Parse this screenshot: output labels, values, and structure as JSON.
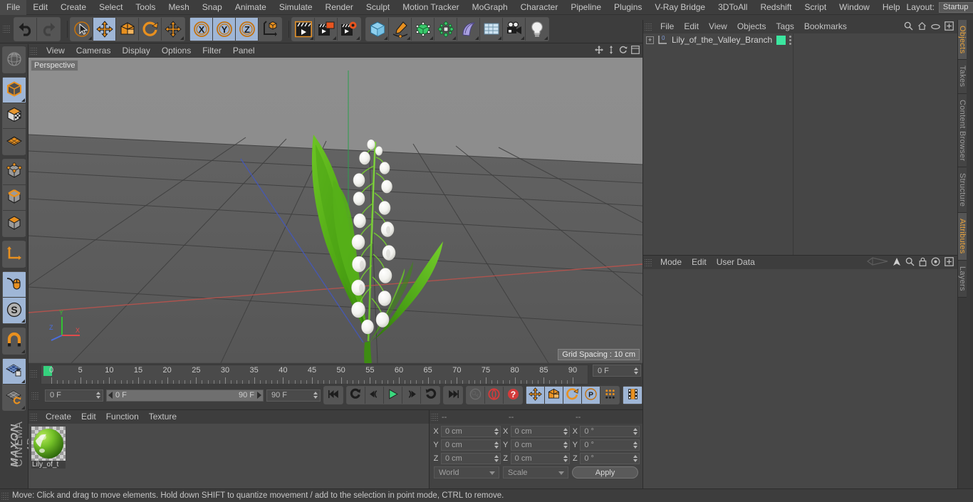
{
  "app": {
    "brand_line1": "MAXON",
    "brand_line2": "CINEMA 4D"
  },
  "menubar": {
    "items": [
      "File",
      "Edit",
      "Create",
      "Select",
      "Tools",
      "Mesh",
      "Snap",
      "Animate",
      "Simulate",
      "Render",
      "Sculpt",
      "Motion Tracker",
      "MoGraph",
      "Character",
      "Pipeline",
      "Plugins",
      "V-Ray Bridge",
      "3DToAll",
      "Redshift",
      "Script",
      "Window",
      "Help"
    ],
    "layout_label": "Layout:",
    "layout_value": "Startup",
    "search_icon": "search-icon"
  },
  "toolbar": {
    "groups": [
      {
        "name": "history",
        "buttons": [
          {
            "name": "undo-button",
            "icon": "undo-icon",
            "selected": false
          },
          {
            "name": "redo-button",
            "icon": "redo-icon",
            "selected": false
          }
        ]
      },
      {
        "name": "tools",
        "buttons": [
          {
            "name": "select-tool-button",
            "icon": "cursor-select-icon",
            "selected": false
          },
          {
            "name": "move-tool-button",
            "icon": "move-arrows-icon",
            "selected": true
          },
          {
            "name": "scale-tool-button",
            "icon": "scale-box-icon",
            "selected": false
          },
          {
            "name": "rotate-tool-button",
            "icon": "rotate-circle-icon",
            "selected": false
          },
          {
            "name": "move-alt-tool-button",
            "icon": "move-arrows-icon",
            "selected": false
          }
        ]
      },
      {
        "name": "axis-locks",
        "buttons": [
          {
            "name": "x-axis-lock-button",
            "icon": "x-axis-icon",
            "selected": true
          },
          {
            "name": "y-axis-lock-button",
            "icon": "y-axis-icon",
            "selected": true
          },
          {
            "name": "z-axis-lock-button",
            "icon": "z-axis-icon",
            "selected": true
          },
          {
            "name": "world-coordinate-button",
            "icon": "world-axis-cube-icon",
            "selected": false
          }
        ]
      },
      {
        "name": "render",
        "buttons": [
          {
            "name": "render-view-button",
            "icon": "clapboard-icon",
            "selected": false
          },
          {
            "name": "render-to-picture-viewer-button",
            "icon": "clapboard-window-icon",
            "selected": false
          },
          {
            "name": "render-settings-button",
            "icon": "clapboard-gear-icon",
            "selected": false
          }
        ]
      },
      {
        "name": "objects",
        "buttons": [
          {
            "name": "add-cube-button",
            "icon": "cube-icon",
            "selected": false
          },
          {
            "name": "add-spline-button",
            "icon": "pen-spline-icon",
            "selected": false
          },
          {
            "name": "add-generator-button",
            "icon": "generator-cube-icon",
            "selected": false
          },
          {
            "name": "add-mograph-button",
            "icon": "cloner-icon",
            "selected": false
          },
          {
            "name": "add-deformer-button",
            "icon": "bend-deformer-icon",
            "selected": false
          },
          {
            "name": "add-environment-button",
            "icon": "floor-grid-icon",
            "selected": false
          },
          {
            "name": "add-camera-button",
            "icon": "camera-icon",
            "selected": false
          },
          {
            "name": "add-light-button",
            "icon": "light-bulb-icon",
            "selected": false
          }
        ]
      }
    ]
  },
  "left_toolbar": {
    "groups": [
      [
        {
          "name": "undo-view-button",
          "icon": "globe-wire-icon",
          "selected": false
        }
      ],
      [
        {
          "name": "model-mode-button",
          "icon": "model-cube-icon",
          "selected": true
        },
        {
          "name": "texture-mode-button",
          "icon": "texture-cube-icon",
          "selected": false
        },
        {
          "name": "uv-mode-button",
          "icon": "uv-mesh-icon",
          "selected": false
        }
      ],
      [
        {
          "name": "points-mode-button",
          "icon": "points-cube-icon",
          "selected": false
        },
        {
          "name": "edges-mode-button",
          "icon": "edges-cube-icon",
          "selected": false
        },
        {
          "name": "polygons-mode-button",
          "icon": "polygons-cube-icon",
          "selected": false
        }
      ],
      [
        {
          "name": "axis-modify-button",
          "icon": "axis-l-icon",
          "selected": false
        }
      ],
      [
        {
          "name": "viewport-solo-button",
          "icon": "mouse-axis-icon",
          "selected": true
        },
        {
          "name": "scale-snap-button",
          "icon": "s-circle-icon",
          "selected": true
        }
      ],
      [
        {
          "name": "enable-snapping-button",
          "icon": "magnet-icon",
          "selected": false
        }
      ],
      [
        {
          "name": "workplane-lock-button",
          "icon": "grid-lock-icon",
          "selected": true
        },
        {
          "name": "workplane-rotate-button",
          "icon": "grid-rotate-icon",
          "selected": false
        }
      ]
    ]
  },
  "viewport": {
    "menu": [
      "View",
      "Cameras",
      "Display",
      "Options",
      "Filter",
      "Panel"
    ],
    "view_label": "Perspective",
    "grid_spacing": "Grid Spacing : 10 cm",
    "axis_labels": {
      "x": "X",
      "y": "Y",
      "z": "Z"
    },
    "axis_colors": {
      "x": "#e04b4b",
      "y": "#33c233",
      "z": "#4a6ee0"
    },
    "background_top": "#8a8a8a",
    "background_bottom": "#5a5a5a",
    "icons": [
      "move-view-icon",
      "scale-view-icon",
      "rotate-view-icon",
      "maximize-view-icon"
    ],
    "scene_object": "Lily_of_the_Valley_Branch"
  },
  "object_manager": {
    "menu": [
      "File",
      "Edit",
      "View",
      "Objects",
      "Tags",
      "Bookmarks"
    ],
    "icons": [
      "search-icon",
      "home-icon",
      "ellipse-icon",
      "new-tab-icon"
    ],
    "object_name": "Lily_of_the_Valley_Branch",
    "object_layer_badge": "0",
    "tag_color": "#3ce6a0"
  },
  "attributes_manager": {
    "menu": [
      "Mode",
      "Edit",
      "User Data"
    ],
    "icons": [
      "history-icon",
      "arrow-up-icon",
      "search-icon",
      "lock-icon",
      "target-icon",
      "new-tab-icon"
    ]
  },
  "vertical_tabs": [
    {
      "label": "Objects",
      "active": true
    },
    {
      "label": "Takes",
      "active": false
    },
    {
      "label": "Content Browser",
      "active": false
    },
    {
      "label": "Structure",
      "active": false
    },
    {
      "label": "Attributes",
      "active": true
    },
    {
      "label": "Layers",
      "active": false
    }
  ],
  "timeline": {
    "ticks": [
      0,
      5,
      10,
      15,
      20,
      25,
      30,
      35,
      40,
      45,
      50,
      55,
      60,
      65,
      70,
      75,
      80,
      85,
      90
    ],
    "min_frame": 0,
    "max_frame": 90,
    "current_frame_field": "0 F",
    "start_field": "0 F",
    "range_start": "0 F",
    "range_end": "90 F",
    "end_field": "90 F",
    "playhead_frame": 0,
    "playhead_color": "#35d17d",
    "controls": [
      {
        "name": "go-to-start-button",
        "icon": "skip-start-icon",
        "selected": false
      },
      {
        "name": "previous-keyframe-button",
        "icon": "rewind-loop-icon",
        "selected": false
      },
      {
        "name": "previous-frame-button",
        "icon": "step-back-icon",
        "selected": false
      },
      {
        "name": "play-button",
        "icon": "play-icon",
        "selected": false
      },
      {
        "name": "next-frame-button",
        "icon": "step-forward-icon",
        "selected": false
      },
      {
        "name": "next-keyframe-button",
        "icon": "forward-loop-icon",
        "selected": false
      },
      {
        "name": "go-to-end-button",
        "icon": "skip-end-icon",
        "selected": false
      },
      {
        "name": "record-active-objects-button",
        "icon": "key-icon",
        "selected": false
      },
      {
        "name": "autokeying-button",
        "icon": "autokey-icon",
        "selected": false
      },
      {
        "name": "keyframe-selection-button",
        "icon": "question-icon",
        "selected": false
      },
      {
        "name": "position-key-button",
        "icon": "move-arrows-icon",
        "selected": true
      },
      {
        "name": "scale-key-button",
        "icon": "scale-box-icon",
        "selected": true
      },
      {
        "name": "rotation-key-button",
        "icon": "rotate-circle-icon",
        "selected": true
      },
      {
        "name": "pla-key-button",
        "icon": "p-circle-icon",
        "selected": true
      },
      {
        "name": "point-level-animation-button",
        "icon": "dot-grid-icon",
        "selected": false
      },
      {
        "name": "timeline-filmstrip-button",
        "icon": "filmstrip-icon",
        "selected": true
      }
    ]
  },
  "material_manager": {
    "menu": [
      "Create",
      "Edit",
      "Function",
      "Texture"
    ],
    "material_name": "Lily_of_t",
    "material_color": "#6fbf2a"
  },
  "coordinates": {
    "headers": [
      "--",
      "--",
      "--"
    ],
    "rows": [
      {
        "axis": "X",
        "position": "0 cm",
        "size": "0 cm",
        "rotation": "0 °"
      },
      {
        "axis": "Y",
        "position": "0 cm",
        "size": "0 cm",
        "rotation": "0 °"
      },
      {
        "axis": "Z",
        "position": "0 cm",
        "size": "0 cm",
        "rotation": "0 °"
      }
    ],
    "coordinate_system": "World",
    "transform_mode": "Scale",
    "apply_label": "Apply"
  },
  "statusbar": {
    "message": "Move: Click and drag to move elements. Hold down SHIFT to quantize movement / add to the selection in point mode, CTRL to remove."
  }
}
